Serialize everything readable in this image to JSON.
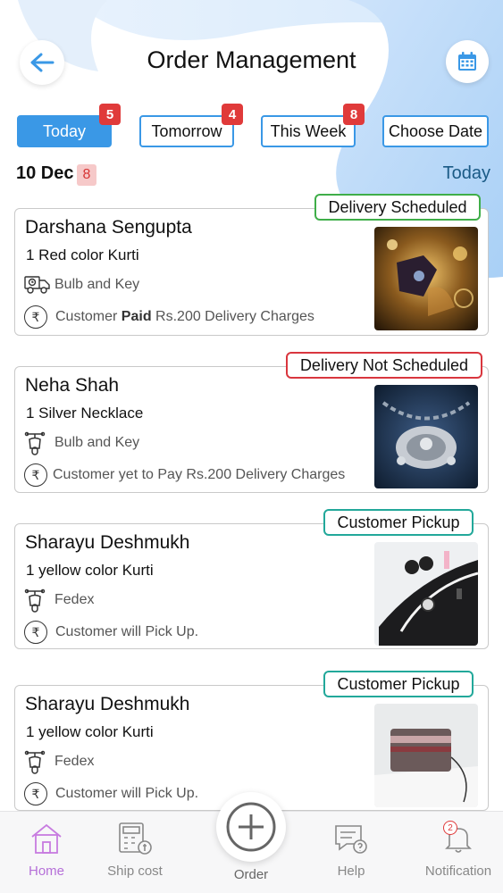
{
  "header": {
    "title": "Order Management",
    "back_icon": "arrow-left-icon",
    "calendar_icon": "calendar-icon"
  },
  "tabs": [
    {
      "label": "Today",
      "badge": "5",
      "active": true
    },
    {
      "label": "Tomorrow",
      "badge": "4"
    },
    {
      "label": "This Week",
      "badge": "8"
    },
    {
      "label": "Choose Date",
      "badge": ""
    }
  ],
  "date_row": {
    "date": "10 Dec",
    "count": "8",
    "right_label": "Today"
  },
  "orders": [
    {
      "status": "Delivery Scheduled",
      "status_color": "#3fae49",
      "customer": "Darshana Sengupta",
      "item": "1 Red color Kurti",
      "ship_icon": "delivery-truck-icon",
      "shipper": "Bulb and Key",
      "pay_prefix": "Customer ",
      "pay_bold": "Paid",
      "pay_suffix": " Rs.200 Delivery Charges",
      "image": "jewelry-ring-box-image"
    },
    {
      "status": "Delivery Not Scheduled",
      "status_color": "#d9363e",
      "customer": "Neha Shah",
      "item": "1 Silver Necklace",
      "ship_icon": "scooter-icon",
      "shipper": "Bulb and Key",
      "pay_text": "Customer yet to Pay Rs.200 Delivery Charges",
      "image": "silver-necklace-image"
    },
    {
      "status": "Customer Pickup",
      "status_color": "#22a89a",
      "customer": "Sharayu Deshmukh",
      "item": "1 yellow color Kurti",
      "ship_icon": "scooter-icon",
      "shipper": "Fedex",
      "pay_text": "Customer will Pick Up.",
      "image": "accessories-flatlay-image"
    },
    {
      "status": "Customer Pickup",
      "status_color": "#22a89a",
      "customer": "Sharayu Deshmukh",
      "item": "1 yellow color Kurti",
      "ship_icon": "scooter-icon",
      "shipper": "Fedex",
      "pay_text": "Customer will Pick Up.",
      "image": "handbag-image"
    }
  ],
  "bottom_nav": {
    "home": "Home",
    "ship_cost": "Ship cost",
    "order": "Order",
    "help": "Help",
    "notification": "Notification",
    "notification_count": "2"
  },
  "colors": {
    "accent": "#3a98e6",
    "badge_red": "#e03a3a",
    "nav_active": "#b56fd8"
  }
}
